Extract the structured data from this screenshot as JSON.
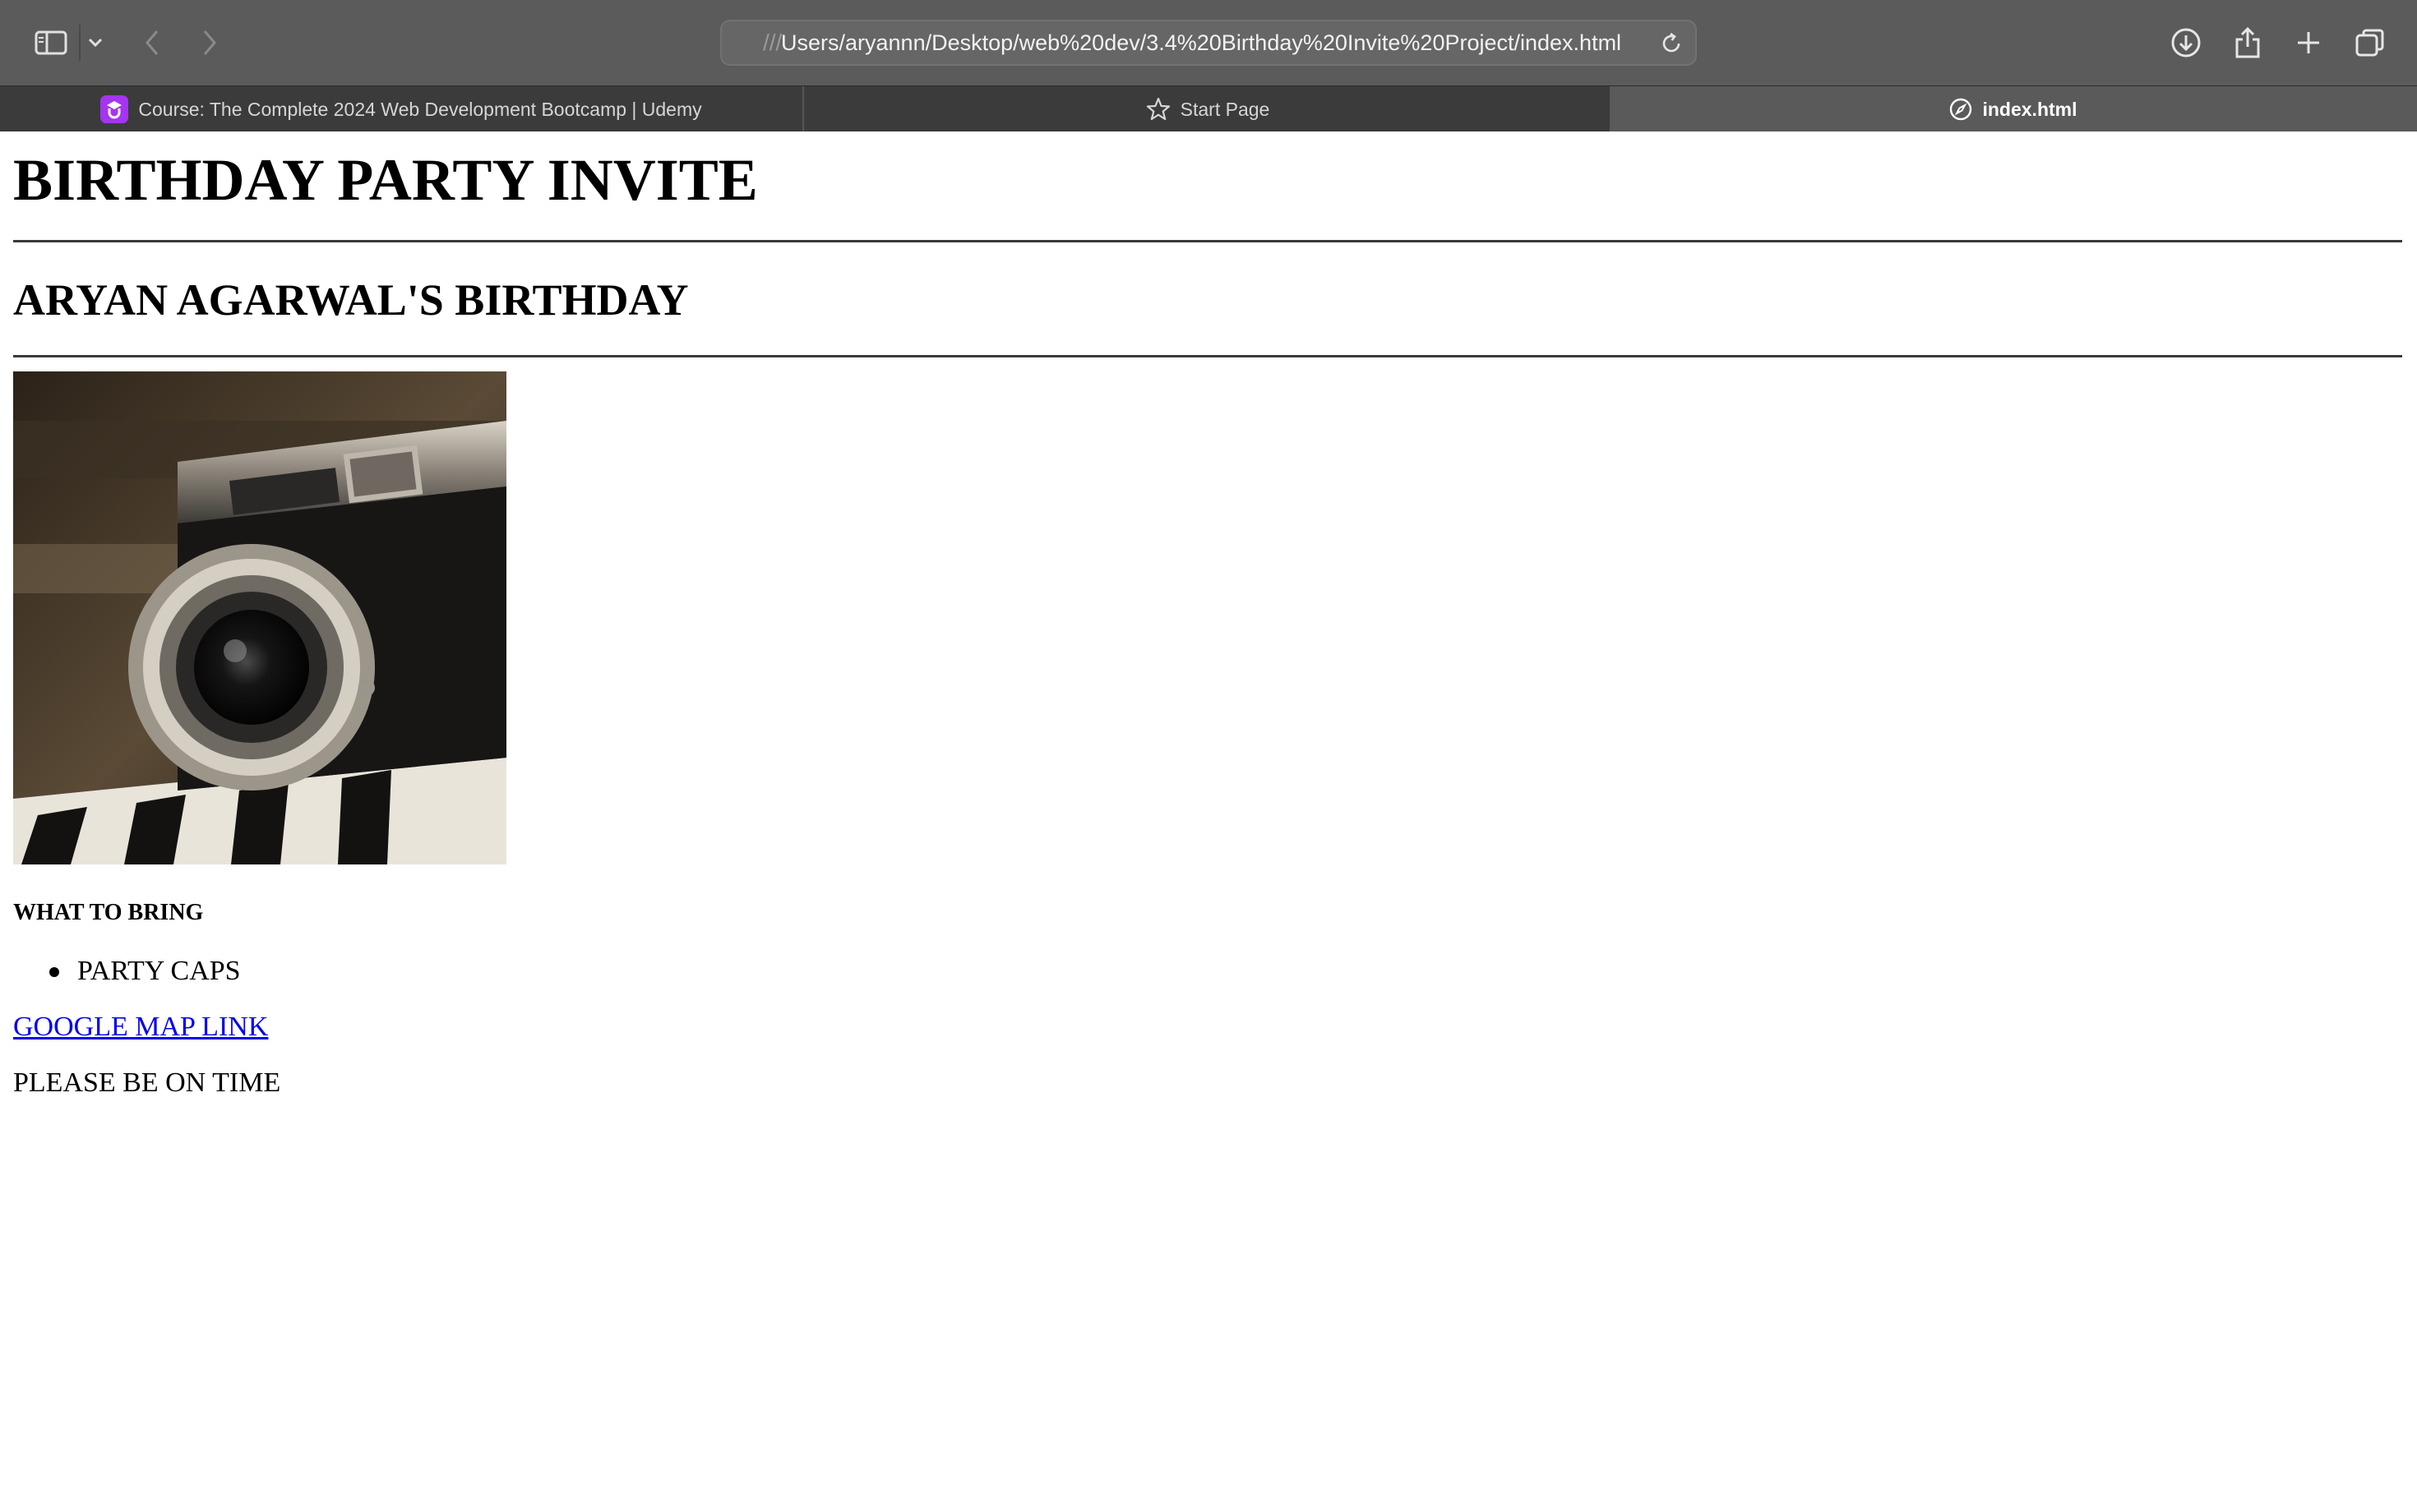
{
  "browser": {
    "address_prefix": "///",
    "address": "Users/aryannn/Desktop/web%20dev/3.4%20Birthday%20Invite%20Project/index.html",
    "icons": {
      "sidebar": "sidebar-icon",
      "sidebar_menu": "chevron-down-icon",
      "back": "chevron-left-icon",
      "forward": "chevron-right-icon",
      "reload": "reload-icon",
      "downloads": "download-icon",
      "share": "share-icon",
      "new_tab": "plus-icon",
      "tab_overview": "tabs-icon"
    },
    "colors": {
      "toolbar": "#5b5b5b",
      "tabbar": "#3b3b3b",
      "active_tab": "#5a5a5a",
      "udemy": "#a435f0"
    },
    "tabs": [
      {
        "label": "Course: The Complete 2024 Web Development Bootcamp | Udemy",
        "icon": "udemy-icon",
        "active": false
      },
      {
        "label": "Start Page",
        "icon": "star-icon",
        "active": false
      },
      {
        "label": "index.html",
        "icon": "compass-icon",
        "active": true
      }
    ]
  },
  "page": {
    "title": "BIRTHDAY PARTY INVITE",
    "subtitle": "ARYAN AGARWAL'S BIRTHDAY",
    "image": "vintage-camera-photo",
    "bring_heading": "WHAT TO BRING",
    "bring_items": [
      "PARTY CAPS"
    ],
    "map_link": "GOOGLE MAP LINK",
    "note": "PLEASE BE ON TIME",
    "link_color": "#0000ee"
  }
}
